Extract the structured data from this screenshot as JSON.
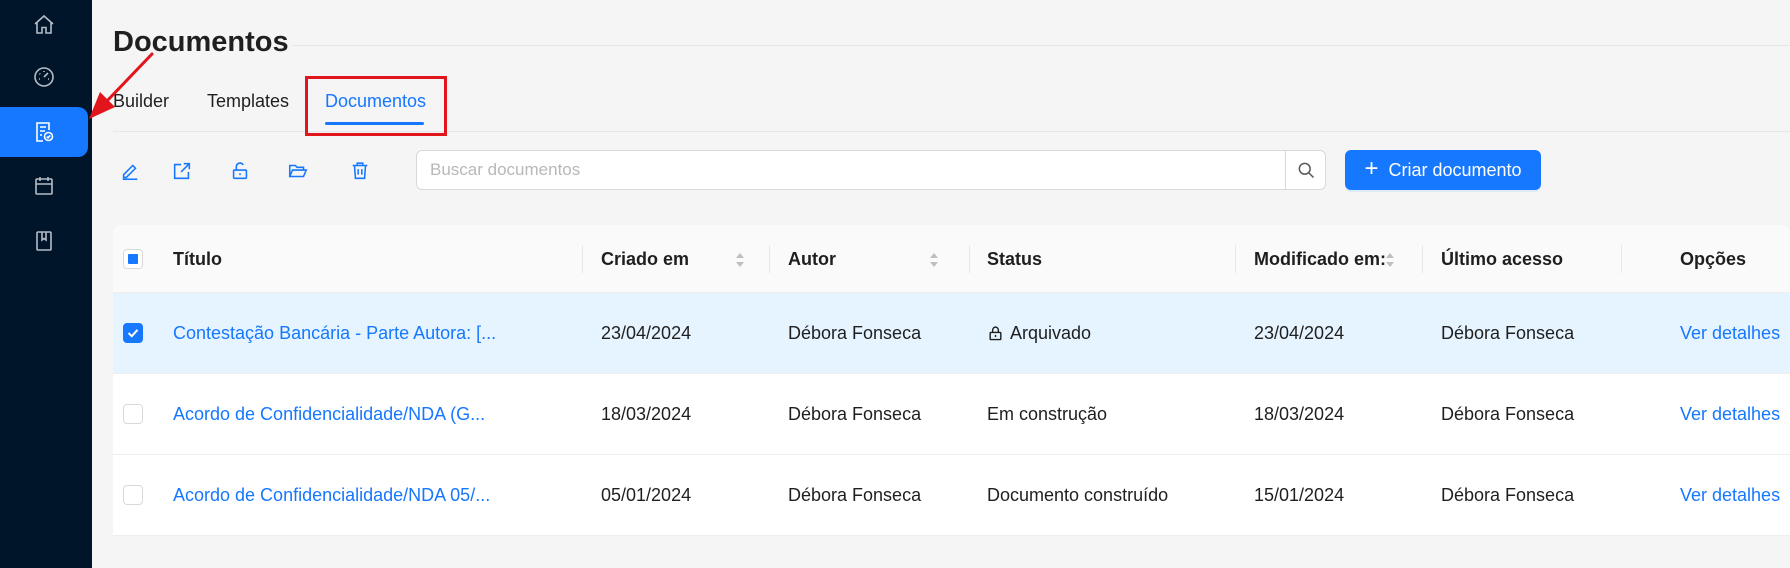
{
  "page": {
    "title": "Documentos"
  },
  "tabs": [
    {
      "label": "Builder"
    },
    {
      "label": "Templates"
    },
    {
      "label": "Documentos",
      "active": true
    }
  ],
  "sidebar": {
    "items": [
      {
        "icon": "home-icon"
      },
      {
        "icon": "dashboard-icon"
      },
      {
        "icon": "document-check-icon",
        "active": true
      },
      {
        "icon": "calendar-icon"
      },
      {
        "icon": "book-icon"
      }
    ]
  },
  "toolbar": {
    "icons": [
      "edit-icon",
      "export-icon",
      "unlock-icon",
      "folder-open-icon",
      "delete-icon"
    ]
  },
  "search": {
    "placeholder": "Buscar documentos",
    "value": ""
  },
  "create_button": {
    "label": "Criar documento"
  },
  "table": {
    "columns": {
      "title": "Título",
      "created": "Criado em",
      "author": "Autor",
      "status": "Status",
      "modified": "Modificado em:",
      "last_access": "Último acesso",
      "options": "Opções"
    },
    "rows": [
      {
        "selected": true,
        "title": "Contestação Bancária - Parte Autora: [...",
        "created": "23/04/2024",
        "author": "Débora Fonseca",
        "status": "Arquivado",
        "status_icon": "lock-icon",
        "modified": "23/04/2024",
        "last_access": "Débora Fonseca",
        "action": "Ver detalhes"
      },
      {
        "selected": false,
        "title": "Acordo de Confidencialidade/NDA (G...",
        "created": "18/03/2024",
        "author": "Débora Fonseca",
        "status": "Em construção",
        "modified": "18/03/2024",
        "last_access": "Débora Fonseca",
        "action": "Ver detalhes"
      },
      {
        "selected": false,
        "title": "Acordo de Confidencialidade/NDA 05/...",
        "created": "05/01/2024",
        "author": "Débora Fonseca",
        "status": "Documento construído",
        "modified": "15/01/2024",
        "last_access": "Débora Fonseca",
        "action": "Ver detalhes"
      }
    ]
  },
  "colors": {
    "primary": "#1677ff",
    "sidebar": "#001529",
    "annotation": "#e2151d",
    "selected_row": "#e6f4ff"
  }
}
